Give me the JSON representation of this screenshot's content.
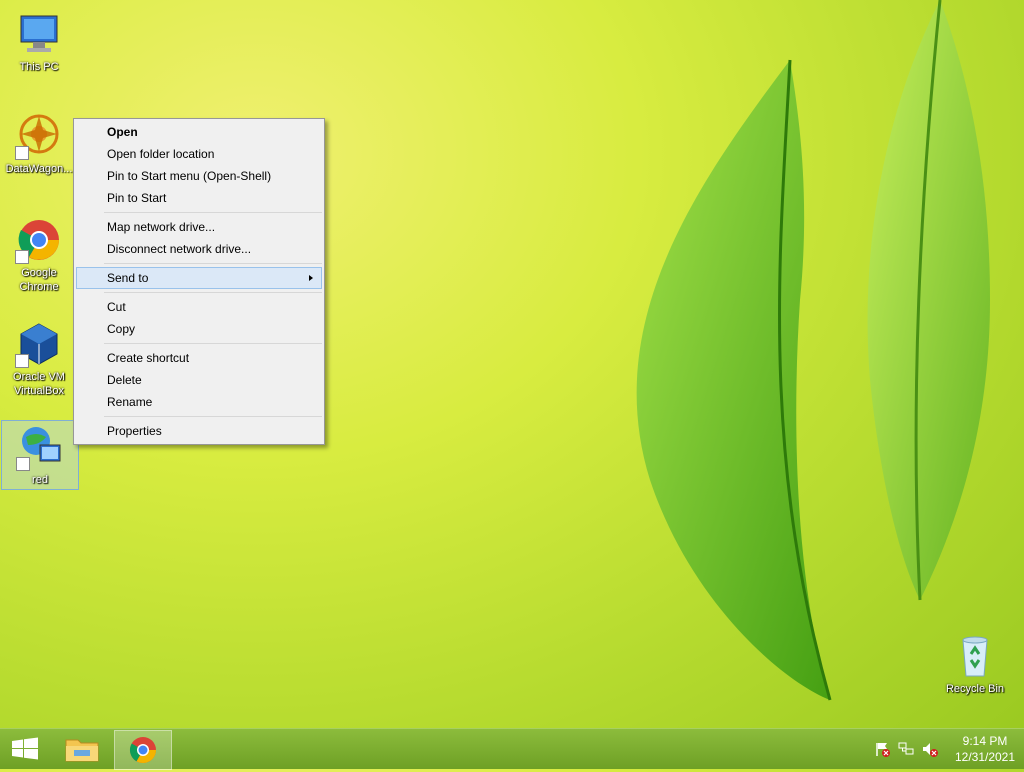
{
  "desktop": {
    "icons": [
      {
        "label": "This PC"
      },
      {
        "label": "DataWagon..."
      },
      {
        "label": "Google Chrome"
      },
      {
        "label": "Oracle VM VirtualBox"
      },
      {
        "label": "red"
      },
      {
        "label": "Recycle Bin"
      }
    ]
  },
  "context_menu": {
    "items": [
      {
        "label": "Open"
      },
      {
        "label": "Open folder location"
      },
      {
        "label": "Pin to Start menu (Open-Shell)"
      },
      {
        "label": "Pin to Start"
      },
      {
        "label": "Map network drive..."
      },
      {
        "label": "Disconnect network drive..."
      },
      {
        "label": "Send to"
      },
      {
        "label": "Cut"
      },
      {
        "label": "Copy"
      },
      {
        "label": "Create shortcut"
      },
      {
        "label": "Delete"
      },
      {
        "label": "Rename"
      },
      {
        "label": "Properties"
      }
    ]
  },
  "taskbar": {
    "clock_time": "9:14 PM",
    "clock_date": "12/31/2021"
  },
  "colors": {
    "taskbar": "#7fb030",
    "menu_bg": "#f0f0f0",
    "menu_hover": "#dbe8f7"
  }
}
